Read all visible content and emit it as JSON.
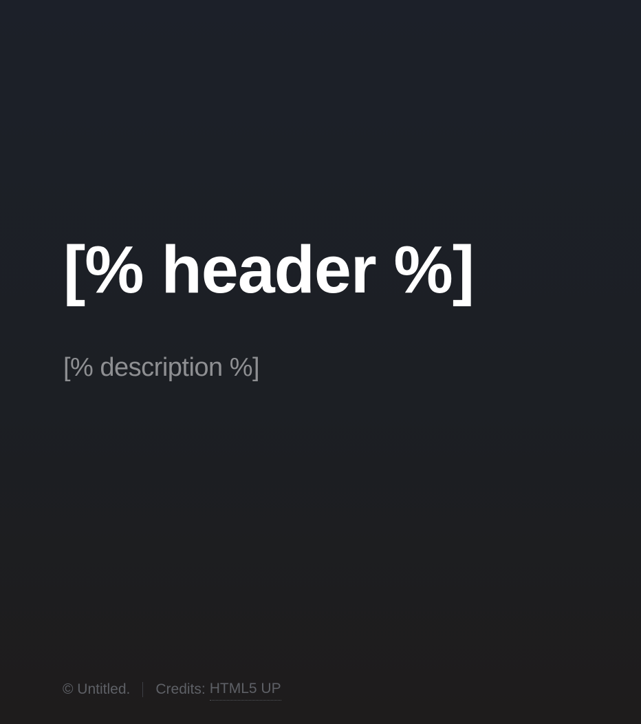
{
  "hero": {
    "title": "[% header %]",
    "description": "[% description %]"
  },
  "footer": {
    "copyright": "© Untitled.",
    "credits_label": "Credits:",
    "credits_link": "HTML5 UP"
  },
  "colors": {
    "background_top": "#1c2029",
    "background_bottom": "#1e1c1c",
    "title": "#ffffff",
    "description": "#8e8f92",
    "footer_text": "#5e6066"
  }
}
